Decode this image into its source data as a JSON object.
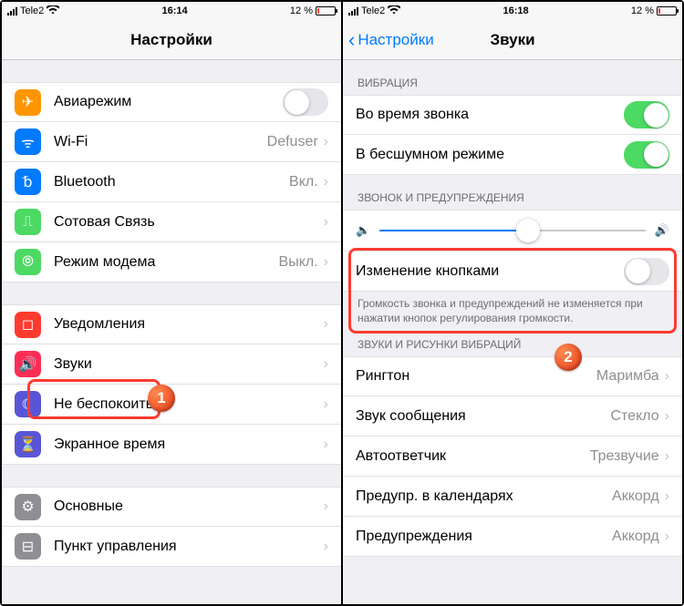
{
  "left": {
    "status": {
      "carrier": "Tele2",
      "time": "16:14",
      "battery_pct": "12 %"
    },
    "title": "Настройки",
    "group1": [
      {
        "icon": "airplane-icon",
        "bg": "bg-orange",
        "glyph": "✈",
        "label": "Авиарежим",
        "type": "toggle",
        "on": false
      },
      {
        "icon": "wifi-icon",
        "bg": "bg-blue",
        "glyph": "ᯤ",
        "label": "Wi-Fi",
        "value": "Defuser",
        "type": "link"
      },
      {
        "icon": "bluetooth-icon",
        "bg": "bg-blue",
        "glyph": "␢",
        "label": "Bluetooth",
        "value": "Вкл.",
        "type": "link"
      },
      {
        "icon": "cellular-icon",
        "bg": "bg-green",
        "glyph": "⎍",
        "label": "Сотовая Связь",
        "value": "",
        "type": "link"
      },
      {
        "icon": "hotspot-icon",
        "bg": "bg-green",
        "glyph": "⦾",
        "label": "Режим модема",
        "value": "Выкл.",
        "type": "link"
      }
    ],
    "group2": [
      {
        "icon": "notifications-icon",
        "bg": "bg-red",
        "glyph": "◻",
        "label": "Уведомления",
        "type": "link"
      },
      {
        "icon": "sounds-icon",
        "bg": "bg-pink",
        "glyph": "🔊",
        "label": "Звуки",
        "type": "link",
        "highlight": true
      },
      {
        "icon": "dnd-icon",
        "bg": "bg-purple",
        "glyph": "☾",
        "label": "Не беспокоить",
        "type": "link"
      },
      {
        "icon": "screentime-icon",
        "bg": "bg-purple",
        "glyph": "⏳",
        "label": "Экранное время",
        "type": "link"
      }
    ],
    "group3": [
      {
        "icon": "general-icon",
        "bg": "bg-gray",
        "glyph": "⚙",
        "label": "Основные",
        "type": "link"
      },
      {
        "icon": "controlcenter-icon",
        "bg": "bg-gray",
        "glyph": "⊟",
        "label": "Пункт управления",
        "type": "link"
      }
    ],
    "badge": "1"
  },
  "right": {
    "status": {
      "carrier": "Tele2",
      "time": "16:18",
      "battery_pct": "12 %"
    },
    "back": "Настройки",
    "title": "Звуки",
    "sec_vibration": "ВИБРАЦИЯ",
    "vib_calls": "Во время звонка",
    "vib_silent": "В бесшумном режиме",
    "sec_ringer": "ЗВОНОК И ПРЕДУПРЕЖДЕНИЯ",
    "change_buttons": "Изменение кнопками",
    "footer": "Громкость звонка и предупреждений не изменяется при нажатии кнопок регулирования громкости.",
    "sec_sounds": "ЗВУКИ И РИСУНКИ ВИБРАЦИЙ",
    "rows": [
      {
        "label": "Рингтон",
        "value": "Маримба"
      },
      {
        "label": "Звук сообщения",
        "value": "Стекло"
      },
      {
        "label": "Автоответчик",
        "value": "Трезвучие"
      },
      {
        "label": "Предупр. в календарях",
        "value": "Аккорд"
      },
      {
        "label": "Предупреждения",
        "value": "Аккорд"
      }
    ],
    "slider_pct": 56,
    "badge": "2"
  }
}
